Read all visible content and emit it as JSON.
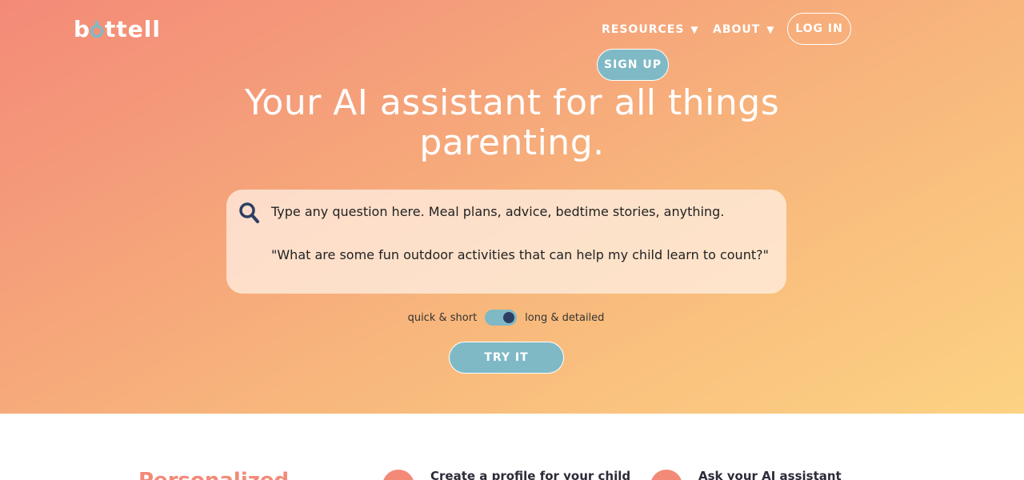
{
  "brand": {
    "logo_text": "bottell"
  },
  "nav": {
    "resources_label": "RESOURCES",
    "about_label": "ABOUT",
    "caret": "▼",
    "login_label": "LOG IN",
    "signup_label": "SIGN UP"
  },
  "hero": {
    "headline": "Your AI assistant for all things parenting.",
    "search": {
      "placeholder": "Type any question here. Meal plans, advice, bedtime stories, anything.",
      "example": "\"What are some fun outdoor activities that can help my child learn to count?\""
    },
    "toggle": {
      "left_label": "quick & short",
      "right_label": "long & detailed",
      "state": "long & detailed"
    },
    "try_label": "TRY IT"
  },
  "features": {
    "section_heading": "Personalized",
    "items": [
      {
        "title": "Create a profile for your child"
      },
      {
        "title": "Ask your AI assistant"
      }
    ]
  },
  "colors": {
    "accent_teal": "#7fb9c6",
    "navy": "#2c3e63",
    "coral": "#f38a78"
  },
  "icons": {
    "search": "search-icon",
    "dropdown": "chevron-down-icon"
  }
}
